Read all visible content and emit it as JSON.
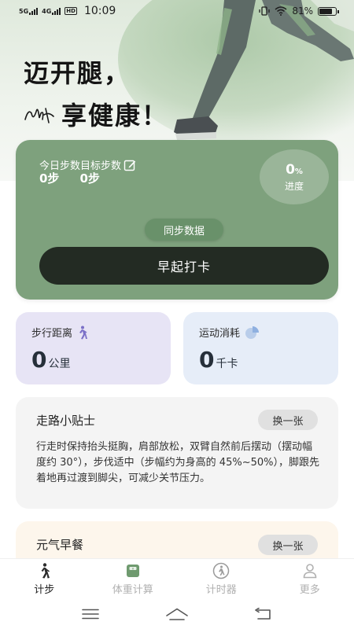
{
  "status_bar": {
    "signal1": "5G",
    "signal2": "4G",
    "hd": "HD",
    "time": "10:09",
    "battery_percent": "81%",
    "battery_level": 0.81
  },
  "hero": {
    "line1": "迈开腿，",
    "line2": "享健康！"
  },
  "today_card": {
    "today_steps_label": "今日步数",
    "target_steps_label": "目标步数",
    "today_steps_value": "0步",
    "target_steps_value": "0步",
    "progress_value": "0",
    "progress_unit": "%",
    "progress_label": "进度",
    "sync_label": "同步数据",
    "checkin_label": "早起打卡",
    "background_color": "#7ea17d"
  },
  "stats": {
    "distance": {
      "title": "步行距离",
      "value": "0",
      "unit": "公里",
      "icon": "walking-person-icon"
    },
    "calories": {
      "title": "运动消耗",
      "value": "0",
      "unit": "千卡",
      "icon": "pie-chart-icon"
    }
  },
  "tips": {
    "title": "走路小贴士",
    "swap_label": "换一张",
    "text": "行走时保持抬头挺胸，肩部放松，双臂自然前后摆动（摆动幅度约 30°），步伐适中（步幅约为身高的 45%~50%），脚跟先着地再过渡到脚尖，可减少关节压力。"
  },
  "breakfast": {
    "title": "元气早餐",
    "swap_label": "换一张"
  },
  "tab_bar": {
    "items": [
      {
        "label": "计步",
        "icon": "walking-icon",
        "active": true
      },
      {
        "label": "体重计算",
        "icon": "scale-icon",
        "active": false
      },
      {
        "label": "计时器",
        "icon": "timer-icon",
        "active": false
      },
      {
        "label": "更多",
        "icon": "person-icon",
        "active": false
      }
    ]
  },
  "system_nav": {
    "icons": [
      "menu-icon",
      "home-icon",
      "back-icon"
    ]
  }
}
